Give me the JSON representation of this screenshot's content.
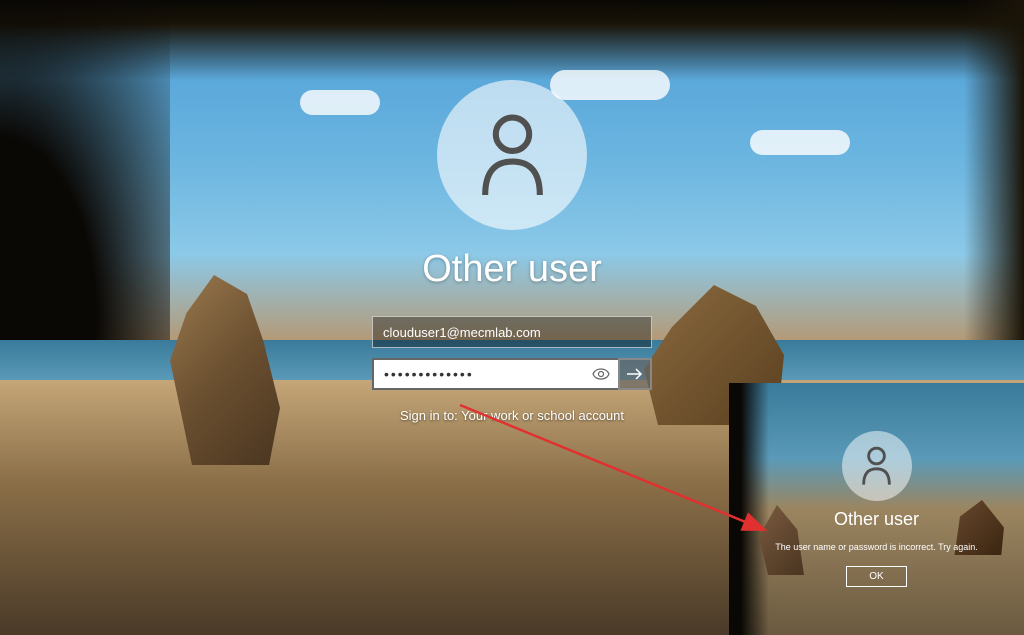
{
  "login": {
    "title": "Other user",
    "username_value": "clouduser1@mecmlab.com",
    "password_value": "•••••••••••••",
    "signin_hint": "Sign in to: Your work or school account"
  },
  "error_inset": {
    "title": "Other user",
    "message": "The user name or password is incorrect. Try again.",
    "ok_label": "OK"
  }
}
